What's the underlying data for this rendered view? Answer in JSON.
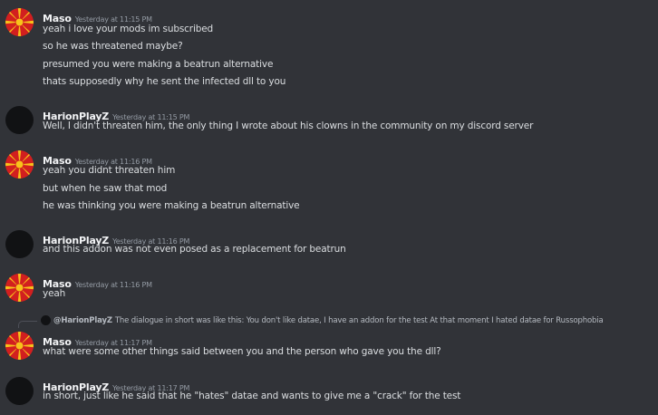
{
  "colors": {
    "background": "#313338",
    "username": "#f2f3f5",
    "timestamp": "#949ba4",
    "message_text": "#dbdee1",
    "avatar_maso_red": "#d21f1f",
    "avatar_maso_gold": "#f7c21b",
    "avatar_harion": "#111214"
  },
  "messages": [
    {
      "author": "Maso",
      "timestamp": "Yesterday at 11:15 PM",
      "avatar": "macedonian-sun-flag-avatar",
      "lines": [
        "yeah i love your mods im subscribed",
        "so he was threatened maybe?",
        "presumed you were making a beatrun alternative",
        "thats supposedly why he sent the infected dll to you"
      ]
    },
    {
      "author": "HarionPlayZ",
      "timestamp": "Yesterday at 11:15 PM",
      "avatar": "black-circle-avatar",
      "lines": [
        "Well, I didn't threaten him, the only thing I wrote about his clowns in the community on my discord server"
      ]
    },
    {
      "author": "Maso",
      "timestamp": "Yesterday at 11:16 PM",
      "avatar": "macedonian-sun-flag-avatar",
      "lines": [
        "yeah you didnt threaten him",
        "but when he saw that mod",
        "he was thinking you were making a beatrun alternative"
      ]
    },
    {
      "author": "HarionPlayZ",
      "timestamp": "Yesterday at 11:16 PM",
      "avatar": "black-circle-avatar",
      "lines": [
        "and this addon was not even posed as a replacement for beatrun"
      ]
    },
    {
      "author": "Maso",
      "timestamp": "Yesterday at 11:16 PM",
      "avatar": "macedonian-sun-flag-avatar",
      "lines": [
        "yeah"
      ]
    },
    {
      "author": "Maso",
      "timestamp": "Yesterday at 11:17 PM",
      "avatar": "macedonian-sun-flag-avatar",
      "reply": {
        "user": "@HarionPlayZ",
        "text": "The dialogue in short was like this: You don't like datae, I have an addon for the test At that moment I hated datae for Russophobia"
      },
      "lines": [
        "what were some other things said between you and the person who gave you the dll?"
      ]
    },
    {
      "author": "HarionPlayZ",
      "timestamp": "Yesterday at 11:17 PM",
      "avatar": "black-circle-avatar",
      "lines": [
        "in short, just like he said that he \"hates\" datae and wants to give me a \"crack\" for the test"
      ]
    }
  ]
}
